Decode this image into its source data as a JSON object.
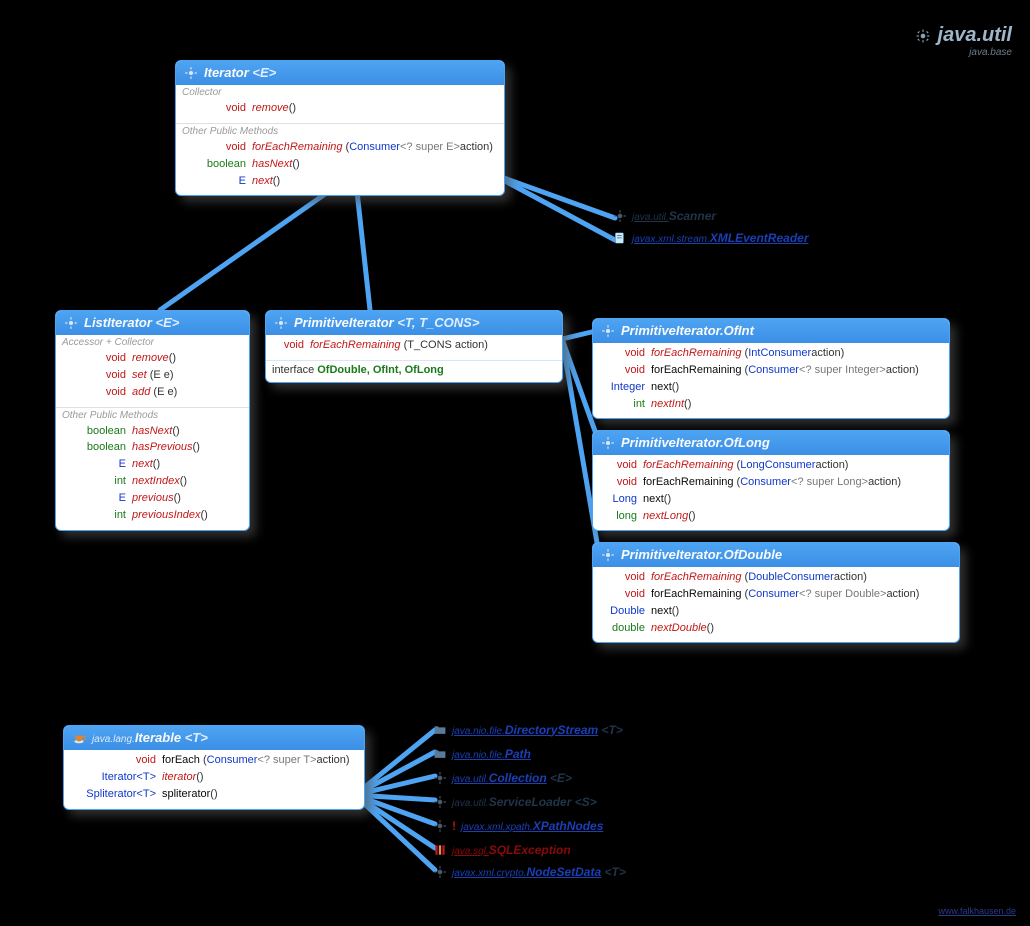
{
  "title": {
    "pkg": "java.util",
    "module": "java.base"
  },
  "credit": "www.falkhausen.de",
  "boxes": {
    "iterator": {
      "title": "Iterator",
      "gen": "<E>",
      "sections": [
        {
          "label": "Collector",
          "rows": [
            {
              "ret": "void",
              "retKind": "void",
              "name": "remove",
              "nameKind": "italic",
              "params": "()"
            }
          ]
        },
        {
          "label": "Other Public Methods",
          "rows": [
            {
              "ret": "void",
              "retKind": "void",
              "name": "forEachRemaining",
              "nameKind": "italic",
              "params": "(",
              "ptype": "Consumer",
              "pgen": "<? super E>",
              "pname": " action)"
            },
            {
              "ret": "boolean",
              "retKind": "prim",
              "name": "hasNext",
              "nameKind": "italic",
              "params": "()"
            },
            {
              "ret": "E",
              "retKind": "obj",
              "name": "next",
              "nameKind": "italic",
              "params": "()"
            }
          ]
        }
      ]
    },
    "listIterator": {
      "title": "ListIterator",
      "gen": "<E>",
      "sections": [
        {
          "label": "Accessor + Collector",
          "rows": [
            {
              "ret": "void",
              "retKind": "void",
              "name": "remove",
              "nameKind": "italic",
              "params": "()"
            },
            {
              "ret": "void",
              "retKind": "void",
              "name": "set",
              "nameKind": "italic",
              "params": "(E e)"
            },
            {
              "ret": "void",
              "retKind": "void",
              "name": "add",
              "nameKind": "italic",
              "params": "(E e)"
            }
          ]
        },
        {
          "label": "Other Public Methods",
          "rows": [
            {
              "ret": "boolean",
              "retKind": "prim",
              "name": "hasNext",
              "nameKind": "italic",
              "params": "()"
            },
            {
              "ret": "boolean",
              "retKind": "prim",
              "name": "hasPrevious",
              "nameKind": "italic",
              "params": "()"
            },
            {
              "ret": "E",
              "retKind": "obj",
              "name": "next",
              "nameKind": "italic",
              "params": "()"
            },
            {
              "ret": "int",
              "retKind": "prim",
              "name": "nextIndex",
              "nameKind": "italic",
              "params": "()"
            },
            {
              "ret": "E",
              "retKind": "obj",
              "name": "previous",
              "nameKind": "italic",
              "params": "()"
            },
            {
              "ret": "int",
              "retKind": "prim",
              "name": "previousIndex",
              "nameKind": "italic",
              "params": "()"
            }
          ]
        }
      ]
    },
    "primIter": {
      "title": "PrimitiveIterator",
      "gen": "<T, T_CONS>",
      "rows": [
        {
          "ret": "void",
          "retKind": "void",
          "name": "forEachRemaining",
          "nameKind": "italic",
          "params": "(T_CONS action)"
        }
      ],
      "ifaceLine": {
        "kw": "interface ",
        "names": "OfDouble,  OfInt,  OfLong"
      }
    },
    "ofInt": {
      "title": "PrimitiveIterator.OfInt",
      "rows": [
        {
          "ret": "void",
          "retKind": "void",
          "name": "forEachRemaining",
          "nameKind": "italic",
          "params": "(",
          "ptype": "IntConsumer",
          "pname": " action)"
        },
        {
          "ret": "void",
          "retKind": "void",
          "name": "forEachRemaining",
          "nameKind": "normal",
          "params": "(",
          "ptype": "Consumer",
          "pgen": "<? super Integer>",
          "pname": " action)"
        },
        {
          "ret": "Integer",
          "retKind": "obj",
          "name": "next",
          "nameKind": "normal",
          "params": "()"
        },
        {
          "ret": "int",
          "retKind": "prim",
          "name": "nextInt",
          "nameKind": "italic",
          "params": "()"
        }
      ]
    },
    "ofLong": {
      "title": "PrimitiveIterator.OfLong",
      "rows": [
        {
          "ret": "void",
          "retKind": "void",
          "name": "forEachRemaining",
          "nameKind": "italic",
          "params": "(",
          "ptype": "LongConsumer",
          "pname": " action)"
        },
        {
          "ret": "void",
          "retKind": "void",
          "name": "forEachRemaining",
          "nameKind": "normal",
          "params": "(",
          "ptype": "Consumer",
          "pgen": "<? super Long>",
          "pname": " action)"
        },
        {
          "ret": "Long",
          "retKind": "obj",
          "name": "next",
          "nameKind": "normal",
          "params": "()"
        },
        {
          "ret": "long",
          "retKind": "prim",
          "name": "nextLong",
          "nameKind": "italic",
          "params": "()"
        }
      ]
    },
    "ofDouble": {
      "title": "PrimitiveIterator.OfDouble",
      "rows": [
        {
          "ret": "void",
          "retKind": "void",
          "name": "forEachRemaining",
          "nameKind": "italic",
          "params": "(",
          "ptype": "DoubleConsumer",
          "pname": " action)"
        },
        {
          "ret": "void",
          "retKind": "void",
          "name": "forEachRemaining",
          "nameKind": "normal",
          "params": "(",
          "ptype": "Consumer",
          "pgen": "<? super Double>",
          "pname": " action)"
        },
        {
          "ret": "Double",
          "retKind": "obj",
          "name": "next",
          "nameKind": "normal",
          "params": "()"
        },
        {
          "ret": "double",
          "retKind": "prim",
          "name": "nextDouble",
          "nameKind": "italic",
          "params": "()"
        }
      ]
    },
    "iterable": {
      "titlePrefix": "java.lang.",
      "title": "Iterable",
      "gen": "<T>",
      "rows": [
        {
          "ret": "void",
          "retKind": "void",
          "name": "forEach",
          "nameKind": "normal",
          "params": "(",
          "ptype": "Consumer",
          "pgen": "<? super T>",
          "pname": " action)"
        },
        {
          "ret": "Iterator<T>",
          "retKind": "obj",
          "name": "iterator",
          "nameKind": "italic",
          "params": "()"
        },
        {
          "ret": "Spliterator<T>",
          "retKind": "obj",
          "name": "spliterator",
          "nameKind": "normal",
          "params": "()"
        }
      ]
    }
  },
  "refs": {
    "scanner": {
      "pkg": "java.util.",
      "cls": "Scanner",
      "color": "navy"
    },
    "xmlEvent": {
      "pkg": "javax.xml.stream.",
      "cls": "XMLEventReader",
      "color": "blue"
    },
    "dirStream": {
      "pkg": "java.nio.file.",
      "cls": "DirectoryStream",
      "gen": "<T>",
      "color": "blue"
    },
    "path": {
      "pkg": "java.nio.file.",
      "cls": "Path",
      "color": "blue"
    },
    "collection": {
      "pkg": "java.util.",
      "cls": "Collection",
      "gen": "<E>",
      "color": "blue"
    },
    "serviceLoader": {
      "pkg": "java.util.",
      "cls": "ServiceLoader",
      "gen": "<S>",
      "color": "navy"
    },
    "xpathNodes": {
      "pkg": "javax.xml.xpath.",
      "cls": "XPathNodes",
      "color": "red",
      "prefix": "! "
    },
    "sqlException": {
      "pkg": "java.sql.",
      "cls": "SQLException",
      "color": "darkred"
    },
    "nodeSetData": {
      "pkg": "javax.xml.crypto.",
      "cls": "NodeSetData",
      "gen": "<T>",
      "color": "blue"
    }
  }
}
